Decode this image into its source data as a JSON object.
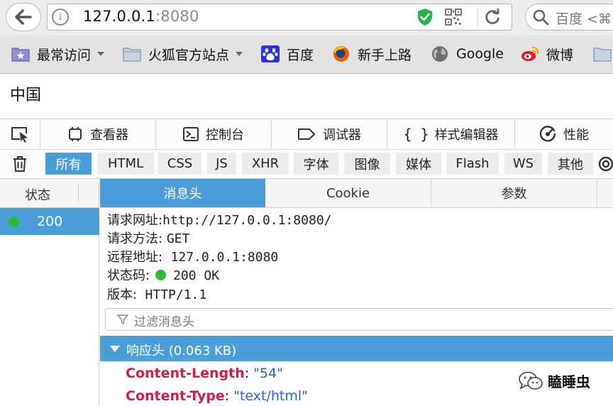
{
  "browser": {
    "url_host": "127.0.0.1",
    "url_port": ":8080",
    "search_placeholder": "百度 <⌘"
  },
  "bookmarks": [
    {
      "label": "最常访问",
      "icon": "star-folder-icon"
    },
    {
      "label": "火狐官方站点",
      "icon": "folder-icon"
    },
    {
      "label": "百度",
      "icon": "baidu-paw-icon"
    },
    {
      "label": "新手上路",
      "icon": "firefox-icon"
    },
    {
      "label": "Google",
      "icon": "globe-icon"
    },
    {
      "label": "微博",
      "icon": "weibo-icon"
    }
  ],
  "page": {
    "text": "中国"
  },
  "devtools": {
    "tabs": [
      "查看器",
      "控制台",
      "调试器",
      "样式编辑器",
      "性能"
    ],
    "filters": [
      "所有",
      "HTML",
      "CSS",
      "JS",
      "XHR",
      "字体",
      "图像",
      "媒体",
      "Flash",
      "WS",
      "其他"
    ],
    "active_filter": "所有",
    "list_header": "状态",
    "request": {
      "status": "200"
    },
    "detail_tabs": [
      "消息头",
      "Cookie",
      "参数"
    ],
    "active_detail_tab": "消息头",
    "summary": {
      "url_label": "请求网址:",
      "url_value": "http://127.0.0.1:8080/",
      "method_label": "请求方法:",
      "method_value": "GET",
      "remote_label": "远程地址:",
      "remote_value": "127.0.0.1:8080",
      "status_label": "状态码:",
      "status_value": "200 OK",
      "version_label": "版本:",
      "version_value": "HTTP/1.1"
    },
    "filter_placeholder": "过滤消息头",
    "response_section": "响应头 (0.063 KB)",
    "headers": [
      {
        "name": "Content-Length",
        "value": "\"54\""
      },
      {
        "name": "Content-Type",
        "value": "\"text/html\""
      }
    ]
  },
  "watermark": {
    "text": "瞌睡虫"
  },
  "colors": {
    "accent": "#4c9ed9",
    "status_ok": "#2cbb30",
    "header_key": "#d6194a",
    "header_value": "#2b62c8"
  }
}
